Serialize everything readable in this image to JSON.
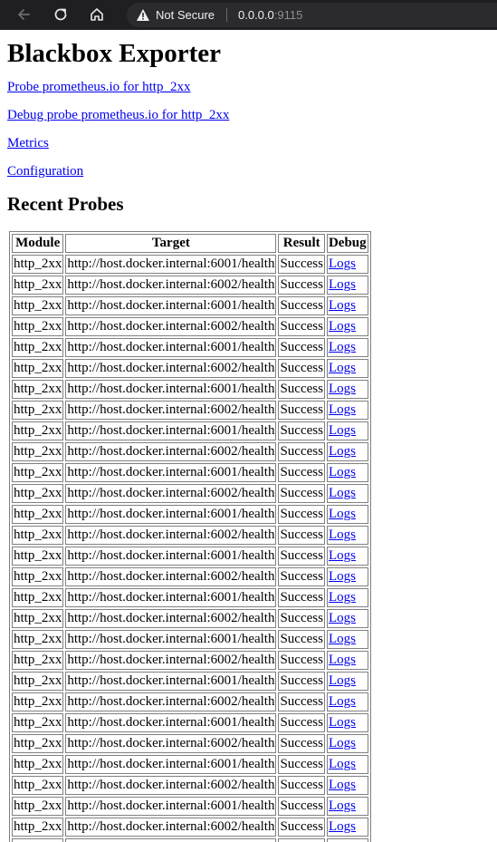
{
  "browser": {
    "security_label": "Not Secure",
    "url_host": "0.0.0.0",
    "url_port": ":9115"
  },
  "page": {
    "title": "Blackbox Exporter",
    "links": [
      "Probe prometheus.io for http_2xx",
      "Debug probe prometheus.io for http_2xx",
      "Metrics",
      "Configuration"
    ],
    "recent_title": "Recent Probes"
  },
  "table": {
    "headers": [
      "Module",
      "Target",
      "Result",
      "Debug"
    ],
    "rows": [
      {
        "module": "http_2xx",
        "target": "http://host.docker.internal:6001/health",
        "result": "Success",
        "debug": "Logs"
      },
      {
        "module": "http_2xx",
        "target": "http://host.docker.internal:6002/health",
        "result": "Success",
        "debug": "Logs"
      },
      {
        "module": "http_2xx",
        "target": "http://host.docker.internal:6001/health",
        "result": "Success",
        "debug": "Logs"
      },
      {
        "module": "http_2xx",
        "target": "http://host.docker.internal:6002/health",
        "result": "Success",
        "debug": "Logs"
      },
      {
        "module": "http_2xx",
        "target": "http://host.docker.internal:6001/health",
        "result": "Success",
        "debug": "Logs"
      },
      {
        "module": "http_2xx",
        "target": "http://host.docker.internal:6002/health",
        "result": "Success",
        "debug": "Logs"
      },
      {
        "module": "http_2xx",
        "target": "http://host.docker.internal:6001/health",
        "result": "Success",
        "debug": "Logs"
      },
      {
        "module": "http_2xx",
        "target": "http://host.docker.internal:6002/health",
        "result": "Success",
        "debug": "Logs"
      },
      {
        "module": "http_2xx",
        "target": "http://host.docker.internal:6001/health",
        "result": "Success",
        "debug": "Logs"
      },
      {
        "module": "http_2xx",
        "target": "http://host.docker.internal:6002/health",
        "result": "Success",
        "debug": "Logs"
      },
      {
        "module": "http_2xx",
        "target": "http://host.docker.internal:6001/health",
        "result": "Success",
        "debug": "Logs"
      },
      {
        "module": "http_2xx",
        "target": "http://host.docker.internal:6002/health",
        "result": "Success",
        "debug": "Logs"
      },
      {
        "module": "http_2xx",
        "target": "http://host.docker.internal:6001/health",
        "result": "Success",
        "debug": "Logs"
      },
      {
        "module": "http_2xx",
        "target": "http://host.docker.internal:6002/health",
        "result": "Success",
        "debug": "Logs"
      },
      {
        "module": "http_2xx",
        "target": "http://host.docker.internal:6001/health",
        "result": "Success",
        "debug": "Logs"
      },
      {
        "module": "http_2xx",
        "target": "http://host.docker.internal:6002/health",
        "result": "Success",
        "debug": "Logs"
      },
      {
        "module": "http_2xx",
        "target": "http://host.docker.internal:6001/health",
        "result": "Success",
        "debug": "Logs"
      },
      {
        "module": "http_2xx",
        "target": "http://host.docker.internal:6002/health",
        "result": "Success",
        "debug": "Logs"
      },
      {
        "module": "http_2xx",
        "target": "http://host.docker.internal:6001/health",
        "result": "Success",
        "debug": "Logs"
      },
      {
        "module": "http_2xx",
        "target": "http://host.docker.internal:6002/health",
        "result": "Success",
        "debug": "Logs"
      },
      {
        "module": "http_2xx",
        "target": "http://host.docker.internal:6001/health",
        "result": "Success",
        "debug": "Logs"
      },
      {
        "module": "http_2xx",
        "target": "http://host.docker.internal:6002/health",
        "result": "Success",
        "debug": "Logs"
      },
      {
        "module": "http_2xx",
        "target": "http://host.docker.internal:6001/health",
        "result": "Success",
        "debug": "Logs"
      },
      {
        "module": "http_2xx",
        "target": "http://host.docker.internal:6002/health",
        "result": "Success",
        "debug": "Logs"
      },
      {
        "module": "http_2xx",
        "target": "http://host.docker.internal:6001/health",
        "result": "Success",
        "debug": "Logs"
      },
      {
        "module": "http_2xx",
        "target": "http://host.docker.internal:6002/health",
        "result": "Success",
        "debug": "Logs"
      },
      {
        "module": "http_2xx",
        "target": "http://host.docker.internal:6001/health",
        "result": "Success",
        "debug": "Logs"
      },
      {
        "module": "http_2xx",
        "target": "http://host.docker.internal:6002/health",
        "result": "Success",
        "debug": "Logs"
      },
      {
        "module": "http_2xx",
        "target": "http://host.docker.internal:6001/health",
        "result": "Success",
        "debug": "Logs"
      }
    ]
  },
  "colors": {
    "link": "#0000ee",
    "toolbar_bg": "#1f1f23",
    "table_border": "#808080"
  },
  "icons": {
    "back": "back-arrow-icon",
    "reload": "reload-icon",
    "home": "home-icon",
    "warning": "warning-triangle-icon"
  }
}
